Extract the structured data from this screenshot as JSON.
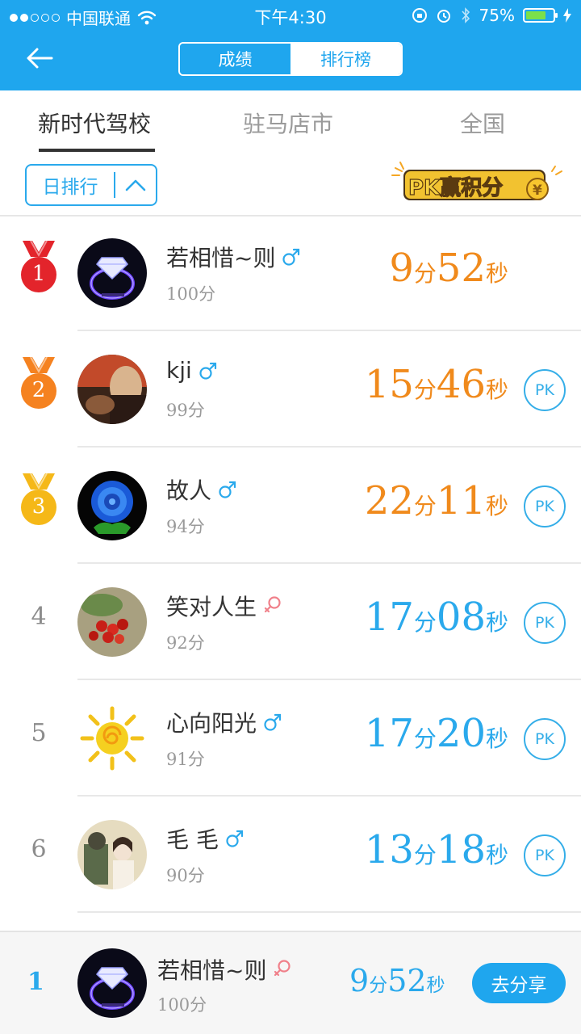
{
  "status_bar": {
    "carrier": "中国联通",
    "time": "下午4:30",
    "battery": "75%",
    "battery_level": 0.75
  },
  "header": {
    "back_icon": "back-arrow-icon",
    "segments": [
      "成绩",
      "排行榜"
    ],
    "active_segment": "成绩"
  },
  "scope_tabs": [
    "新时代驾校",
    "驻马店市",
    "全国"
  ],
  "active_scope": "新时代驾校",
  "filter": {
    "label": "日排行"
  },
  "pk_banner": {
    "text": "PK赢积分",
    "coin": "¥"
  },
  "ranking": [
    {
      "rank": "1",
      "name": "若相惜~则",
      "gender": "male",
      "score": "100分",
      "min": "9",
      "sec": "52",
      "min_unit": "分",
      "sec_unit": "秒",
      "pk": "",
      "color": "#f08a1c"
    },
    {
      "rank": "2",
      "name": "kji",
      "gender": "male",
      "score": "99分",
      "min": "15",
      "sec": "46",
      "min_unit": "分",
      "sec_unit": "秒",
      "pk": "PK",
      "color": "#f08a1c"
    },
    {
      "rank": "3",
      "name": "故人",
      "gender": "male",
      "score": "94分",
      "min": "22",
      "sec": "11",
      "min_unit": "分",
      "sec_unit": "秒",
      "pk": "PK",
      "color": "#f08a1c"
    },
    {
      "rank": "4",
      "name": "笑对人生",
      "gender": "female",
      "score": "92分",
      "min": "17",
      "sec": "08",
      "min_unit": "分",
      "sec_unit": "秒",
      "pk": "PK",
      "color": "#2aa9ec"
    },
    {
      "rank": "5",
      "name": "心向阳光",
      "gender": "male",
      "score": "91分",
      "min": "17",
      "sec": "20",
      "min_unit": "分",
      "sec_unit": "秒",
      "pk": "PK",
      "color": "#2aa9ec"
    },
    {
      "rank": "6",
      "name": "毛 毛",
      "gender": "male",
      "score": "90分",
      "min": "13",
      "sec": "18",
      "min_unit": "分",
      "sec_unit": "秒",
      "pk": "PK",
      "color": "#2aa9ec"
    }
  ],
  "footer": {
    "rank": "1",
    "name": "若相惜~则",
    "gender": "female",
    "score": "100分",
    "min": "9",
    "sec": "52",
    "min_unit": "分",
    "sec_unit": "秒",
    "share_label": "去分享"
  },
  "colors": {
    "primary": "#1fa6ee",
    "gold_time": "#f08a1c",
    "blue_time": "#2aa9ec",
    "medal_1": "#e3242b",
    "medal_2": "#f58220",
    "medal_3": "#f5b818",
    "male": "#2aa9ec",
    "female": "#f0808a"
  }
}
